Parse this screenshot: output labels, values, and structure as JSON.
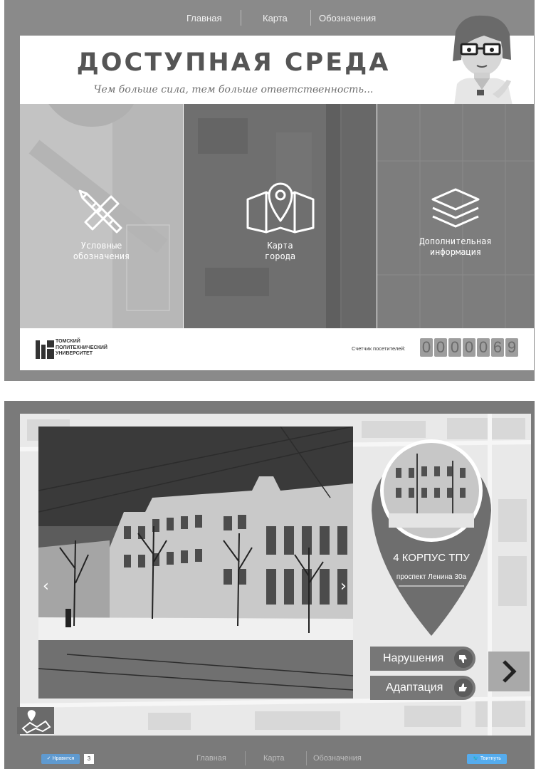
{
  "top_screen": {
    "nav": [
      "Главная",
      "Карта",
      "Обозначения"
    ],
    "title": "ДОСТУПНАЯ СРЕДА",
    "tagline": "Чем больше сила, тем больше ответственность...",
    "panels": [
      {
        "label_line1": "Условные",
        "label_line2": "обозначения",
        "icon": "pencil-ruler-icon"
      },
      {
        "label_line1": "Карта",
        "label_line2": "города",
        "icon": "map-pin-icon"
      },
      {
        "label_line1": "Дополнительная",
        "label_line2": "информация",
        "icon": "layers-icon"
      }
    ],
    "university": {
      "line1": "ТОМСКИЙ",
      "line2": "ПОЛИТЕХНИЧЕСКИЙ",
      "line3": "УНИВЕРСИТЕТ"
    },
    "counter_label": "Счетчик посетителей:",
    "counter_digits": [
      "0",
      "0",
      "0",
      "0",
      "0",
      "6",
      "9"
    ],
    "colors": {
      "frame": "#8a8a8a",
      "title": "#555555",
      "panel_legend": "#c3c3c3",
      "panel_map": "#6f6f6f",
      "panel_info": "#7d7d7d"
    }
  },
  "bottom_screen": {
    "location_title": "4 КОРПУС ТПУ",
    "location_address": "проспект Ленина 30а",
    "violations_label": "Нарушения",
    "adaptation_label": "Адаптация",
    "slider_dot_count": 9,
    "slider_active_index": 0,
    "like_label": "Нравится",
    "like_count": "3",
    "nav": [
      "Главная",
      "Карта",
      "Обозначения"
    ],
    "tweet_label": "Твитнуть",
    "colors": {
      "pin": "#6e6e6e",
      "button": "#777777",
      "next_button": "#a9a9a9",
      "like": "#5f9ad0",
      "tweet": "#55acee"
    }
  }
}
